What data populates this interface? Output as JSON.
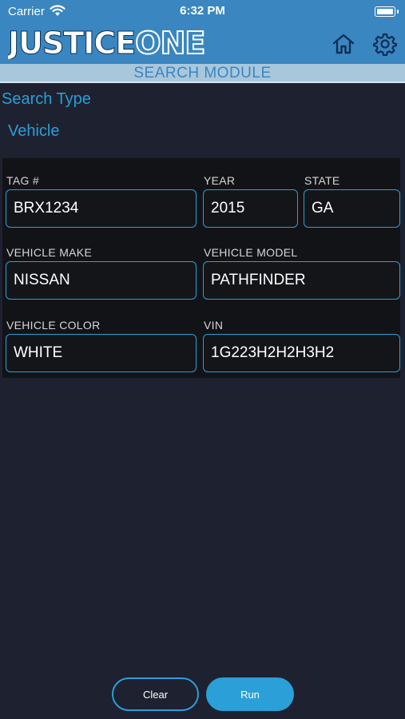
{
  "status_bar": {
    "carrier": "Carrier",
    "time": "6:32 PM"
  },
  "header": {
    "logo_text": "JUSTICEONE",
    "logo_part1": "JUSTICE",
    "logo_part2": "ONE",
    "icons": [
      "home-icon",
      "gear-icon"
    ]
  },
  "module_title": "SEARCH MODULE",
  "search_type": {
    "label": "Search Type",
    "value": "Vehicle"
  },
  "form": {
    "tag": {
      "label": "TAG #",
      "value": "BRX1234"
    },
    "year": {
      "label": "YEAR",
      "value": "2015"
    },
    "state": {
      "label": "STATE",
      "value": "GA"
    },
    "make": {
      "label": "VEHICLE MAKE",
      "value": "NISSAN"
    },
    "model": {
      "label": "VEHICLE MODEL",
      "value": "PATHFINDER"
    },
    "color": {
      "label": "VEHICLE COLOR",
      "value": "WHITE"
    },
    "vin": {
      "label": "VIN",
      "value": "1G223H2H2H3H2"
    }
  },
  "actions": {
    "clear_label": "Clear",
    "run_label": "Run"
  },
  "colors": {
    "header_blue": "#3a86c0",
    "accent_blue": "#2a9fd8",
    "background": "#1e2130",
    "panel": "#121317"
  }
}
